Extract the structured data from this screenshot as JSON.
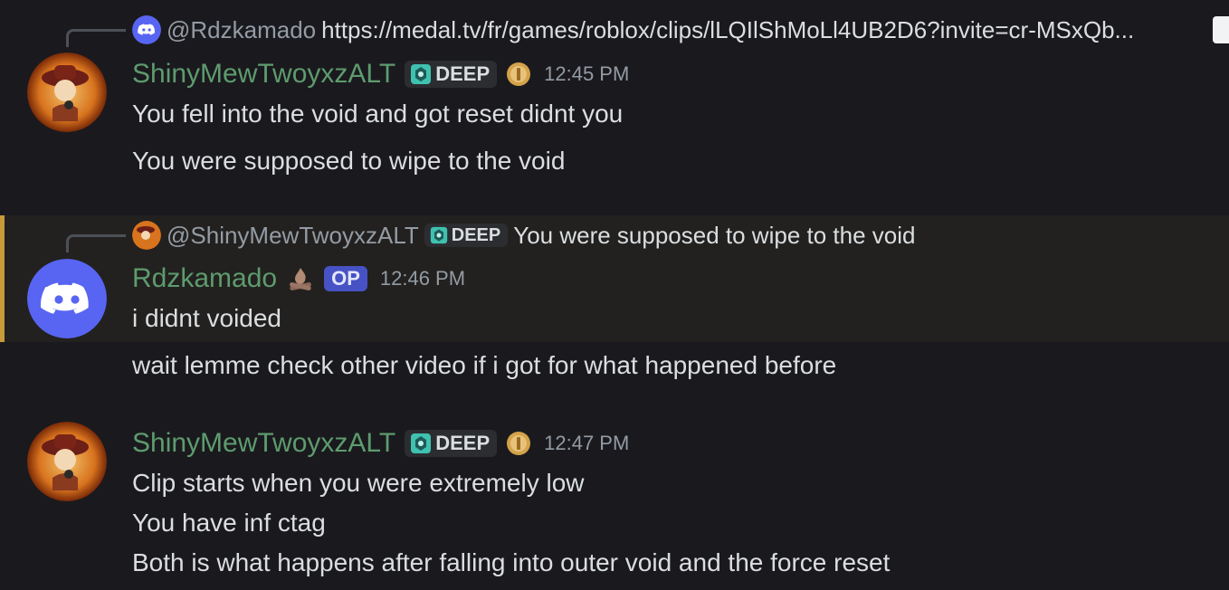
{
  "messages": [
    {
      "reply": {
        "mention": "@Rdzkamado",
        "text": "https://medal.tv/fr/games/roblox/clips/lLQIlShMoLl4UB2D6?invite=cr-MSxQb..."
      },
      "author": "ShinyMewTwoyxzALT",
      "tag": "DEEP",
      "time": "12:45 PM",
      "lines": [
        "You fell into the void and got reset didnt you",
        "You were supposed to wipe to the void"
      ]
    },
    {
      "reply": {
        "mention": "@ShinyMewTwoyxzALT",
        "tag": "DEEP",
        "text": "You were supposed to wipe to the void"
      },
      "author": "Rdzkamado",
      "badge": "OP",
      "time": "12:46 PM",
      "lines": [
        "i didnt voided",
        "wait lemme check other video if i got for what happened before"
      ]
    },
    {
      "author": "ShinyMewTwoyxzALT",
      "tag": "DEEP",
      "time": "12:47 PM",
      "lines": [
        "Clip starts when you were extremely low",
        "You have inf ctag",
        "Both is what happens after falling into outer void and the force reset"
      ]
    }
  ],
  "colors": {
    "background": "#1a1a1e",
    "username": "#5e9b6e",
    "highlight_bar": "#c79a3a",
    "discord_blurple": "#5865f2"
  }
}
